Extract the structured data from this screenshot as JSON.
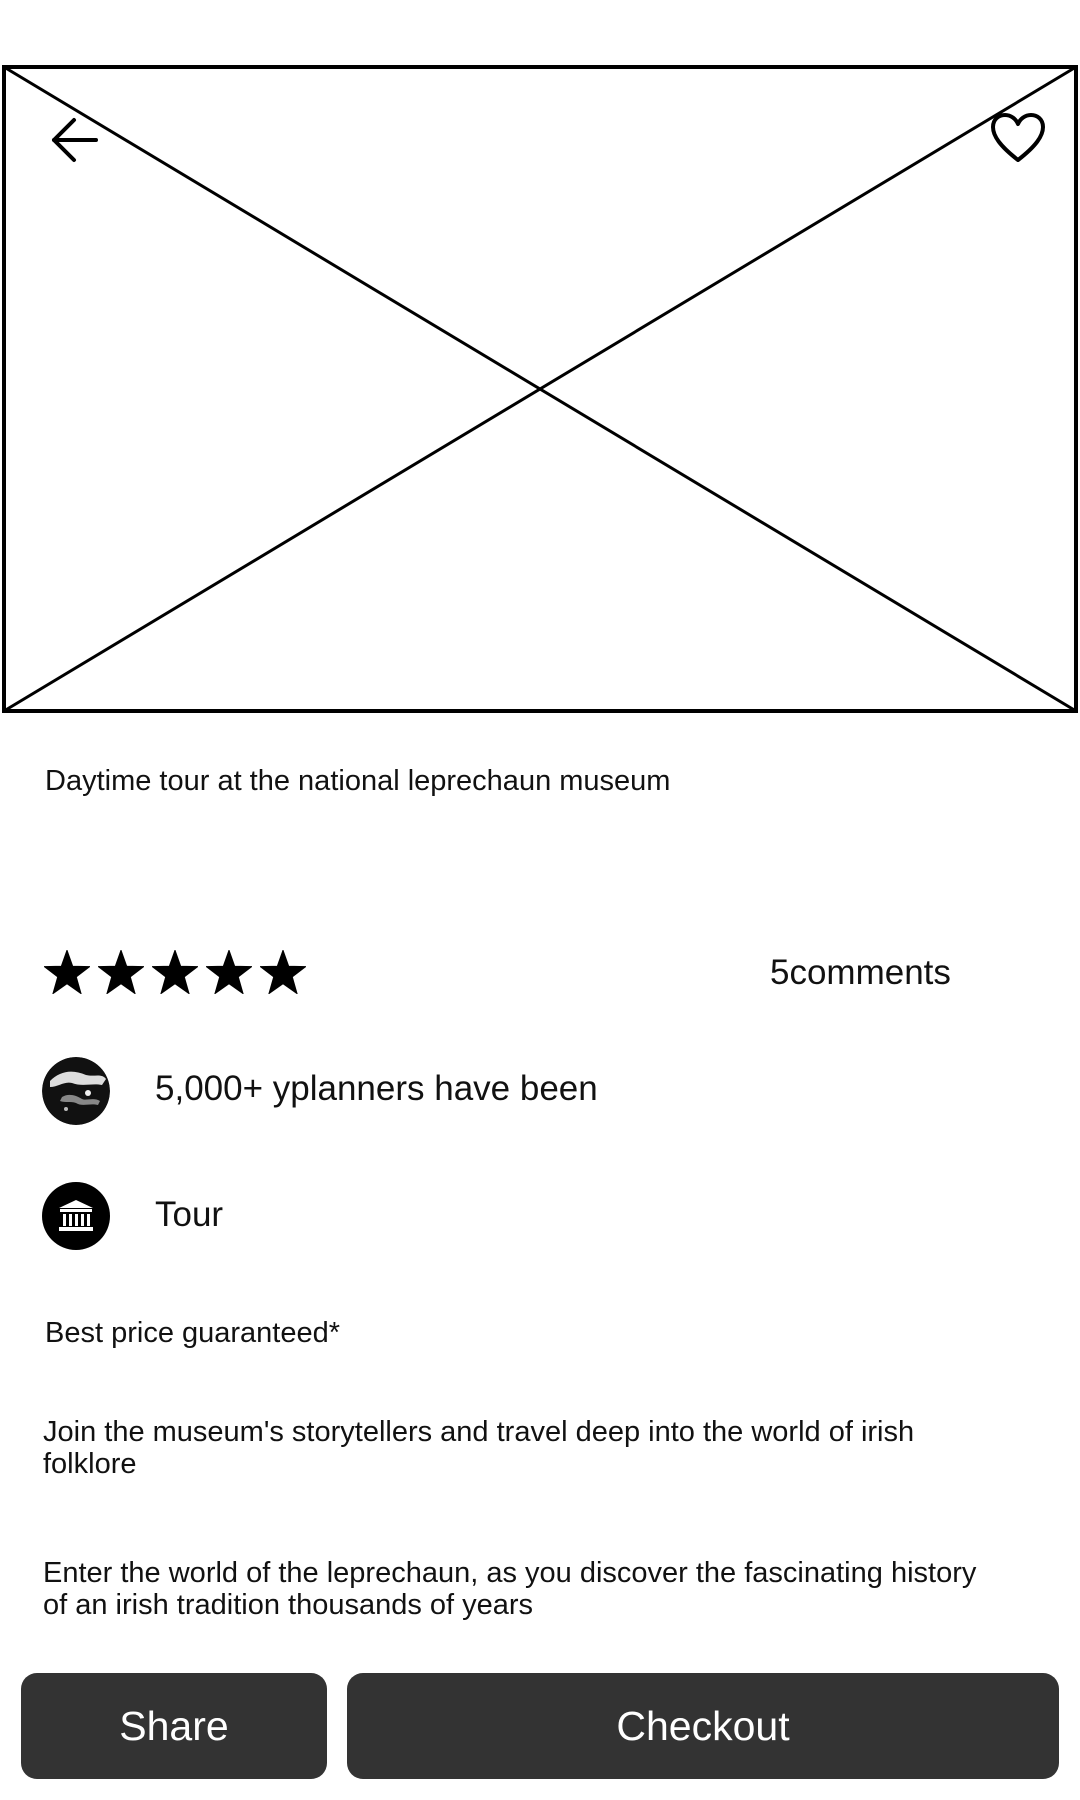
{
  "hero": {
    "image_placeholder": "image-placeholder",
    "back_icon": "arrow-left-icon",
    "favorite_icon": "heart-outline-icon"
  },
  "event": {
    "title": "Daytime tour at the national leprechaun museum",
    "rating": {
      "value": 5,
      "max": 5,
      "icon": "star-icon"
    },
    "comments": "5comments",
    "visitors": {
      "icon": "visitors-photo-icon",
      "text": "5,000+ yplanners have been"
    },
    "category": {
      "icon": "museum-icon",
      "text": "Tour"
    },
    "price_note": "Best price guaranteed*",
    "description_1": "Join the museum's storytellers and travel deep into the world of irish folklore",
    "description_2": "Enter the world of the leprechaun, as you discover the fascinating history of an irish tradition thousands of years"
  },
  "actions": {
    "share_label": "Share",
    "checkout_label": "Checkout"
  },
  "colors": {
    "button_bg": "#333333",
    "button_text": "#ffffff",
    "text": "#111111"
  }
}
